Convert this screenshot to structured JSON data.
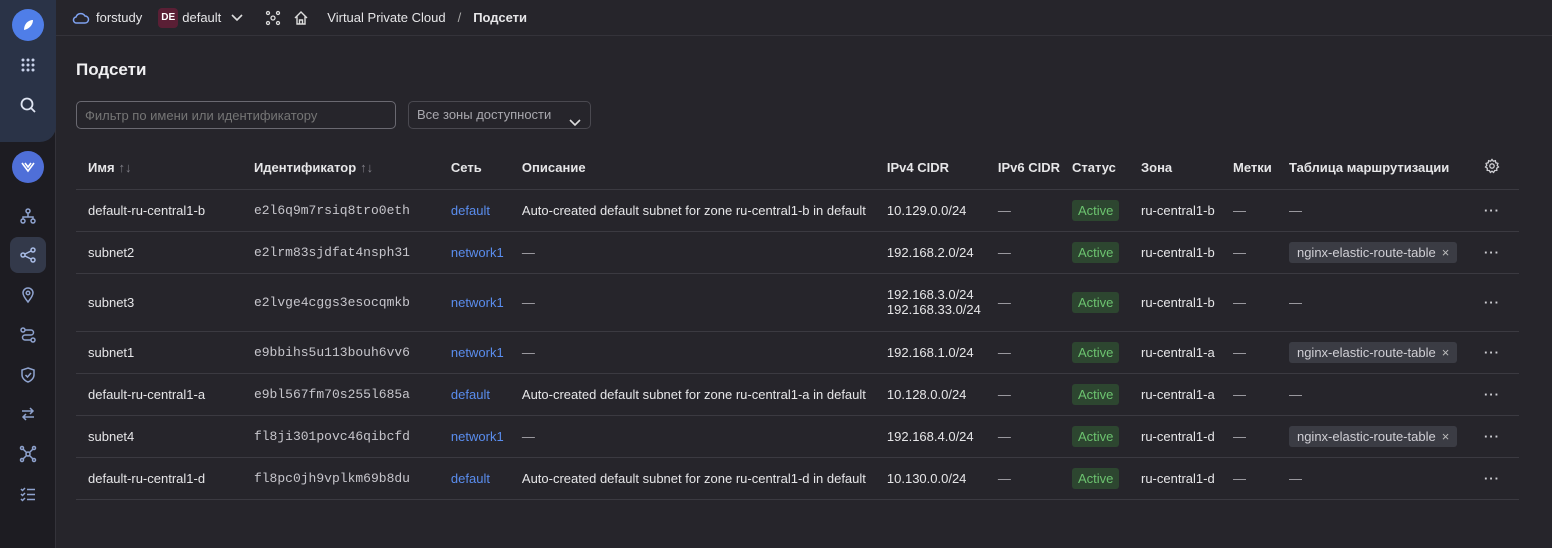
{
  "topbar": {
    "cloud_name": "forstudy",
    "folder_badge": "DE",
    "folder_name": "default",
    "breadcrumb_service": "Virtual Private Cloud",
    "breadcrumb_sep": "/",
    "breadcrumb_current": "Подсети"
  },
  "page": {
    "title": "Подсети",
    "filter_placeholder": "Фильтр по имени или идентификатору",
    "zone_select_value": "Все зоны доступности"
  },
  "table": {
    "headers": {
      "name": "Имя",
      "id": "Идентификатор",
      "network": "Сеть",
      "description": "Описание",
      "ipv4": "IPv4 CIDR",
      "ipv6": "IPv6 CIDR",
      "status": "Статус",
      "zone": "Зона",
      "labels": "Метки",
      "route_table": "Таблица маршрутизации",
      "sort_glyph": "↑↓"
    },
    "rows": [
      {
        "name": "default-ru-central1-b",
        "id": "e2l6q9m7rsiq8tro0eth",
        "network": "default",
        "description": "Auto-created default subnet for zone ru-central1-b in default",
        "ipv4": "10.129.0.0/24",
        "ipv4_2": "",
        "ipv6": "—",
        "status": "Active",
        "zone": "ru-central1-b",
        "labels": "—",
        "route_table": "—"
      },
      {
        "name": "subnet2",
        "id": "e2lrm83sjdfat4nsph31",
        "network": "network1",
        "description": "—",
        "ipv4": "192.168.2.0/24",
        "ipv4_2": "",
        "ipv6": "—",
        "status": "Active",
        "zone": "ru-central1-b",
        "labels": "—",
        "route_table": "nginx-elastic-route-table"
      },
      {
        "name": "subnet3",
        "id": "e2lvge4cggs3esocqmkb",
        "network": "network1",
        "description": "—",
        "ipv4": "192.168.3.0/24",
        "ipv4_2": "192.168.33.0/24",
        "ipv6": "—",
        "status": "Active",
        "zone": "ru-central1-b",
        "labels": "—",
        "route_table": "—"
      },
      {
        "name": "subnet1",
        "id": "e9bbihs5u113bouh6vv6",
        "network": "network1",
        "description": "—",
        "ipv4": "192.168.1.0/24",
        "ipv4_2": "",
        "ipv6": "—",
        "status": "Active",
        "zone": "ru-central1-a",
        "labels": "—",
        "route_table": "nginx-elastic-route-table"
      },
      {
        "name": "default-ru-central1-a",
        "id": "e9bl567fm70s255l685a",
        "network": "default",
        "description": "Auto-created default subnet for zone ru-central1-a in default",
        "ipv4": "10.128.0.0/24",
        "ipv4_2": "",
        "ipv6": "—",
        "status": "Active",
        "zone": "ru-central1-a",
        "labels": "—",
        "route_table": "—"
      },
      {
        "name": "subnet4",
        "id": "fl8ji301povc46qibcfd",
        "network": "network1",
        "description": "—",
        "ipv4": "192.168.4.0/24",
        "ipv4_2": "",
        "ipv6": "—",
        "status": "Active",
        "zone": "ru-central1-d",
        "labels": "—",
        "route_table": "nginx-elastic-route-table"
      },
      {
        "name": "default-ru-central1-d",
        "id": "fl8pc0jh9vplkm69b8du",
        "network": "default",
        "description": "Auto-created default subnet for zone ru-central1-d in default",
        "ipv4": "10.130.0.0/24",
        "ipv4_2": "",
        "ipv6": "—",
        "status": "Active",
        "zone": "ru-central1-d",
        "labels": "—",
        "route_table": "—"
      }
    ],
    "row_menu_glyph": "···",
    "tag_remove_glyph": "×"
  },
  "colors": {
    "accent": "#4f7ee8",
    "link": "#5a8dee",
    "status_active_bg": "#2d4630",
    "status_active_fg": "#6cc36f"
  },
  "icons": {
    "rail": [
      "logo-icon",
      "apps-grid-icon",
      "search-icon",
      "vpc-service-icon",
      "network-topology-icon",
      "subnets-icon",
      "location-pin-icon",
      "routes-icon",
      "shield-icon",
      "transfer-icon",
      "graph-icon",
      "list-check-icon"
    ],
    "topbar": [
      "cloud-icon",
      "chevron-down-icon",
      "hub-icon",
      "home-icon"
    ],
    "table": [
      "settings-gear-icon",
      "more-dots-icon"
    ]
  }
}
